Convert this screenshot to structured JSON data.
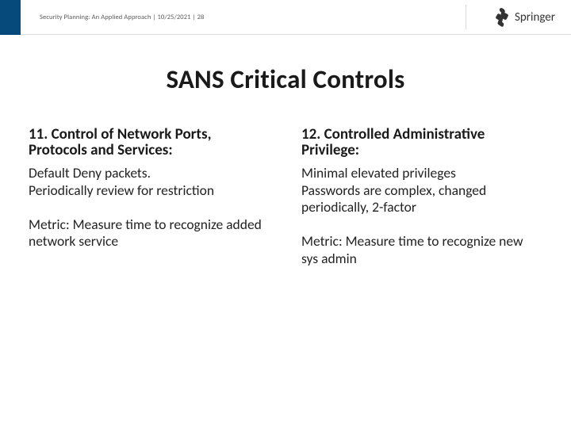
{
  "header": {
    "breadcrumb": "Security Planning: An Applied Approach | 10/25/2021 | 28",
    "brand": "Springer"
  },
  "title": "SANS Critical Controls",
  "left": {
    "heading": "11. Control of Network Ports, Protocols and Services:",
    "line1": "Default Deny packets.",
    "line2": "Periodically review for restriction",
    "metric": "Metric:  Measure time to recognize added network service"
  },
  "right": {
    "heading": "12. Controlled Administrative Privilege:",
    "line1": "Minimal elevated privileges",
    "line2": "Passwords are complex, changed periodically, 2-factor",
    "metric": "Metric:  Measure time to recognize new sys admin"
  }
}
